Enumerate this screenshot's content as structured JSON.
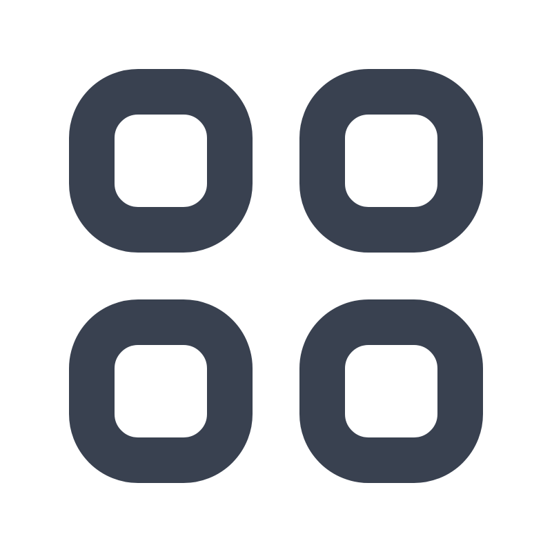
{
  "icon": {
    "name": "grid-icon",
    "variant": "four-rounded-squares-outline",
    "color": "#394150",
    "background": "#ffffff"
  }
}
